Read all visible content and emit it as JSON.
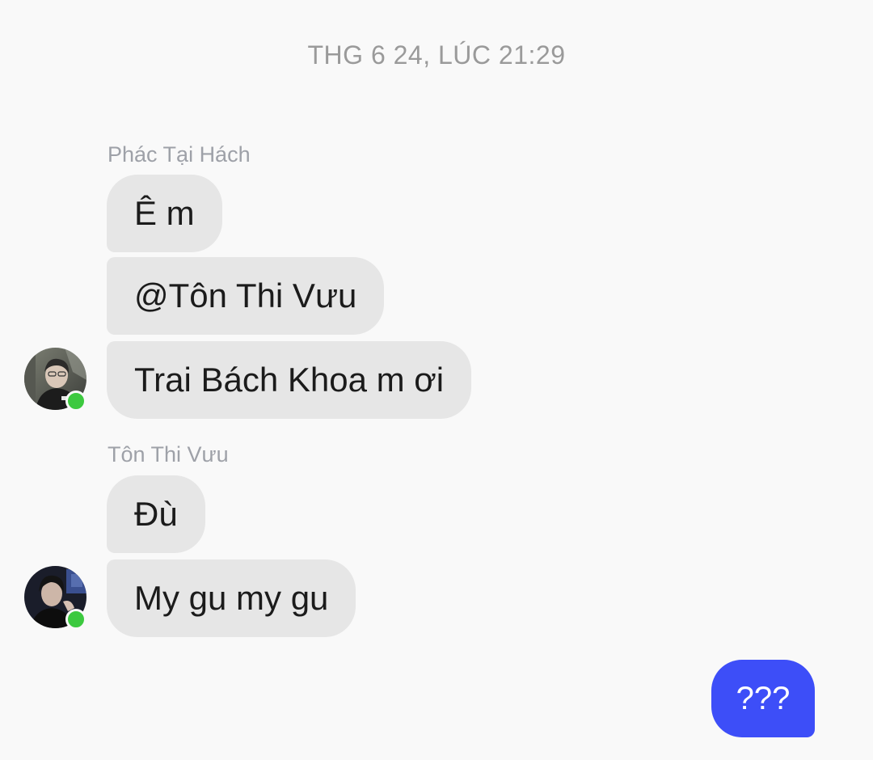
{
  "conversation": {
    "timestamp": "THG 6 24, LÚC 21:29",
    "groups": [
      {
        "sender": "Phác Tại Hách",
        "messages": [
          "Ê m",
          "@Tôn Thi Vưu",
          "Trai Bách Khoa m ơi"
        ],
        "avatar_icon": "avatar-photo",
        "online": true,
        "online_color": "#3cc93f"
      },
      {
        "sender": "Tôn Thi Vưu",
        "messages": [
          "Đù",
          "My gu my gu"
        ],
        "avatar_icon": "avatar-photo",
        "online": true,
        "online_color": "#3cc93f"
      }
    ],
    "outgoing": {
      "messages": [
        "???"
      ],
      "bubble_color": "#3d4ef8"
    },
    "incoming_bubble_color": "#e6e6e6"
  }
}
